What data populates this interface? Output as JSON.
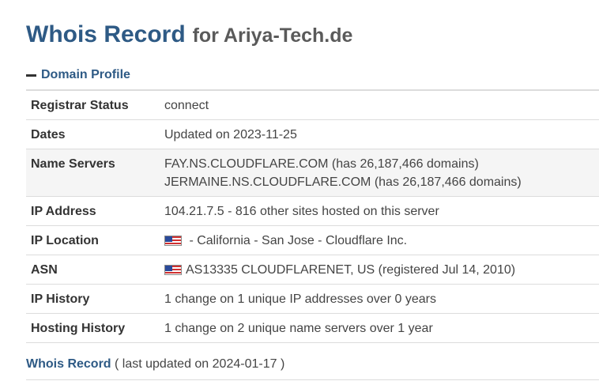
{
  "header": {
    "title": "Whois Record",
    "subtitle": "for Ariya-Tech.de"
  },
  "section": {
    "label": "Domain Profile",
    "icon": "minus-icon"
  },
  "profile": {
    "registrar_status": {
      "label": "Registrar Status",
      "value": "connect"
    },
    "dates": {
      "label": "Dates",
      "value": "Updated on 2023-11-25"
    },
    "name_servers": {
      "label": "Name Servers",
      "values": [
        "FAY.NS.CLOUDFLARE.COM (has 26,187,466 domains)",
        "JERMAINE.NS.CLOUDFLARE.COM (has 26,187,466 domains)"
      ]
    },
    "ip_address": {
      "label": "IP Address",
      "value": "104.21.7.5 - 816 other sites hosted on this server"
    },
    "ip_location": {
      "label": "IP Location",
      "value": " - California - San Jose - Cloudflare Inc.",
      "flag_icon": "us-flag-icon"
    },
    "asn": {
      "label": "ASN",
      "value": "AS13335 CLOUDFLARENET, US (registered Jul 14, 2010)",
      "flag_icon": "us-flag-icon"
    },
    "ip_history": {
      "label": "IP History",
      "value": "1 change on 1 unique IP addresses over 0 years"
    },
    "hosting_history": {
      "label": "Hosting History",
      "value": "1 change on 2 unique name servers over 1 year"
    }
  },
  "footer": {
    "link": "Whois Record",
    "note": " ( last updated on 2024-01-17 )"
  },
  "colors": {
    "accent": "#2e5a85",
    "subtitle": "#5a5a5a",
    "row_shade": "#f5f5f5",
    "border": "#dcdcdc"
  }
}
